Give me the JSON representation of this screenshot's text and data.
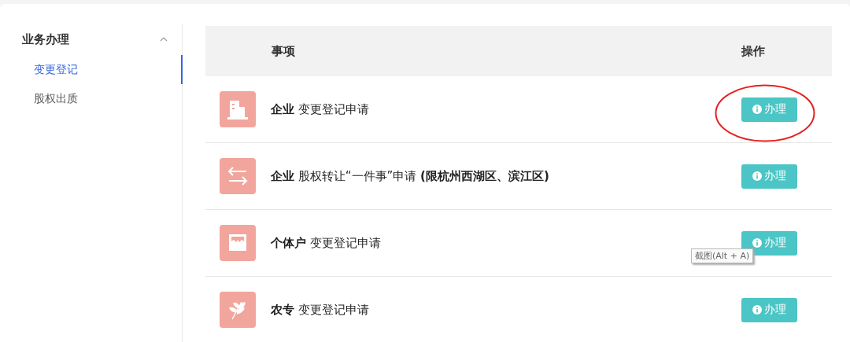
{
  "sidebar": {
    "group": {
      "title": "业务办理",
      "expanded": true
    },
    "items": [
      {
        "label": "变更登记",
        "selected": true
      },
      {
        "label": "股权出质",
        "selected": false
      }
    ]
  },
  "table": {
    "columns": [
      "事项",
      "操作"
    ],
    "rows": [
      {
        "kind": "building",
        "title": "**企业** 变更登记申请",
        "action": "办理",
        "circled": true
      },
      {
        "kind": "transfer",
        "title": "**企业** 股权转让“一件事”申请 **(限杭州西湖区、滨江区)**",
        "action": "办理",
        "circled": false
      },
      {
        "kind": "shop",
        "title": "**个体户** 变更登记申请",
        "action": "办理",
        "circled": false
      },
      {
        "kind": "wheat",
        "title": "**农专** 变更登记申请",
        "action": "办理",
        "circled": false
      }
    ]
  },
  "tooltip": "截图(Alt + A)"
}
